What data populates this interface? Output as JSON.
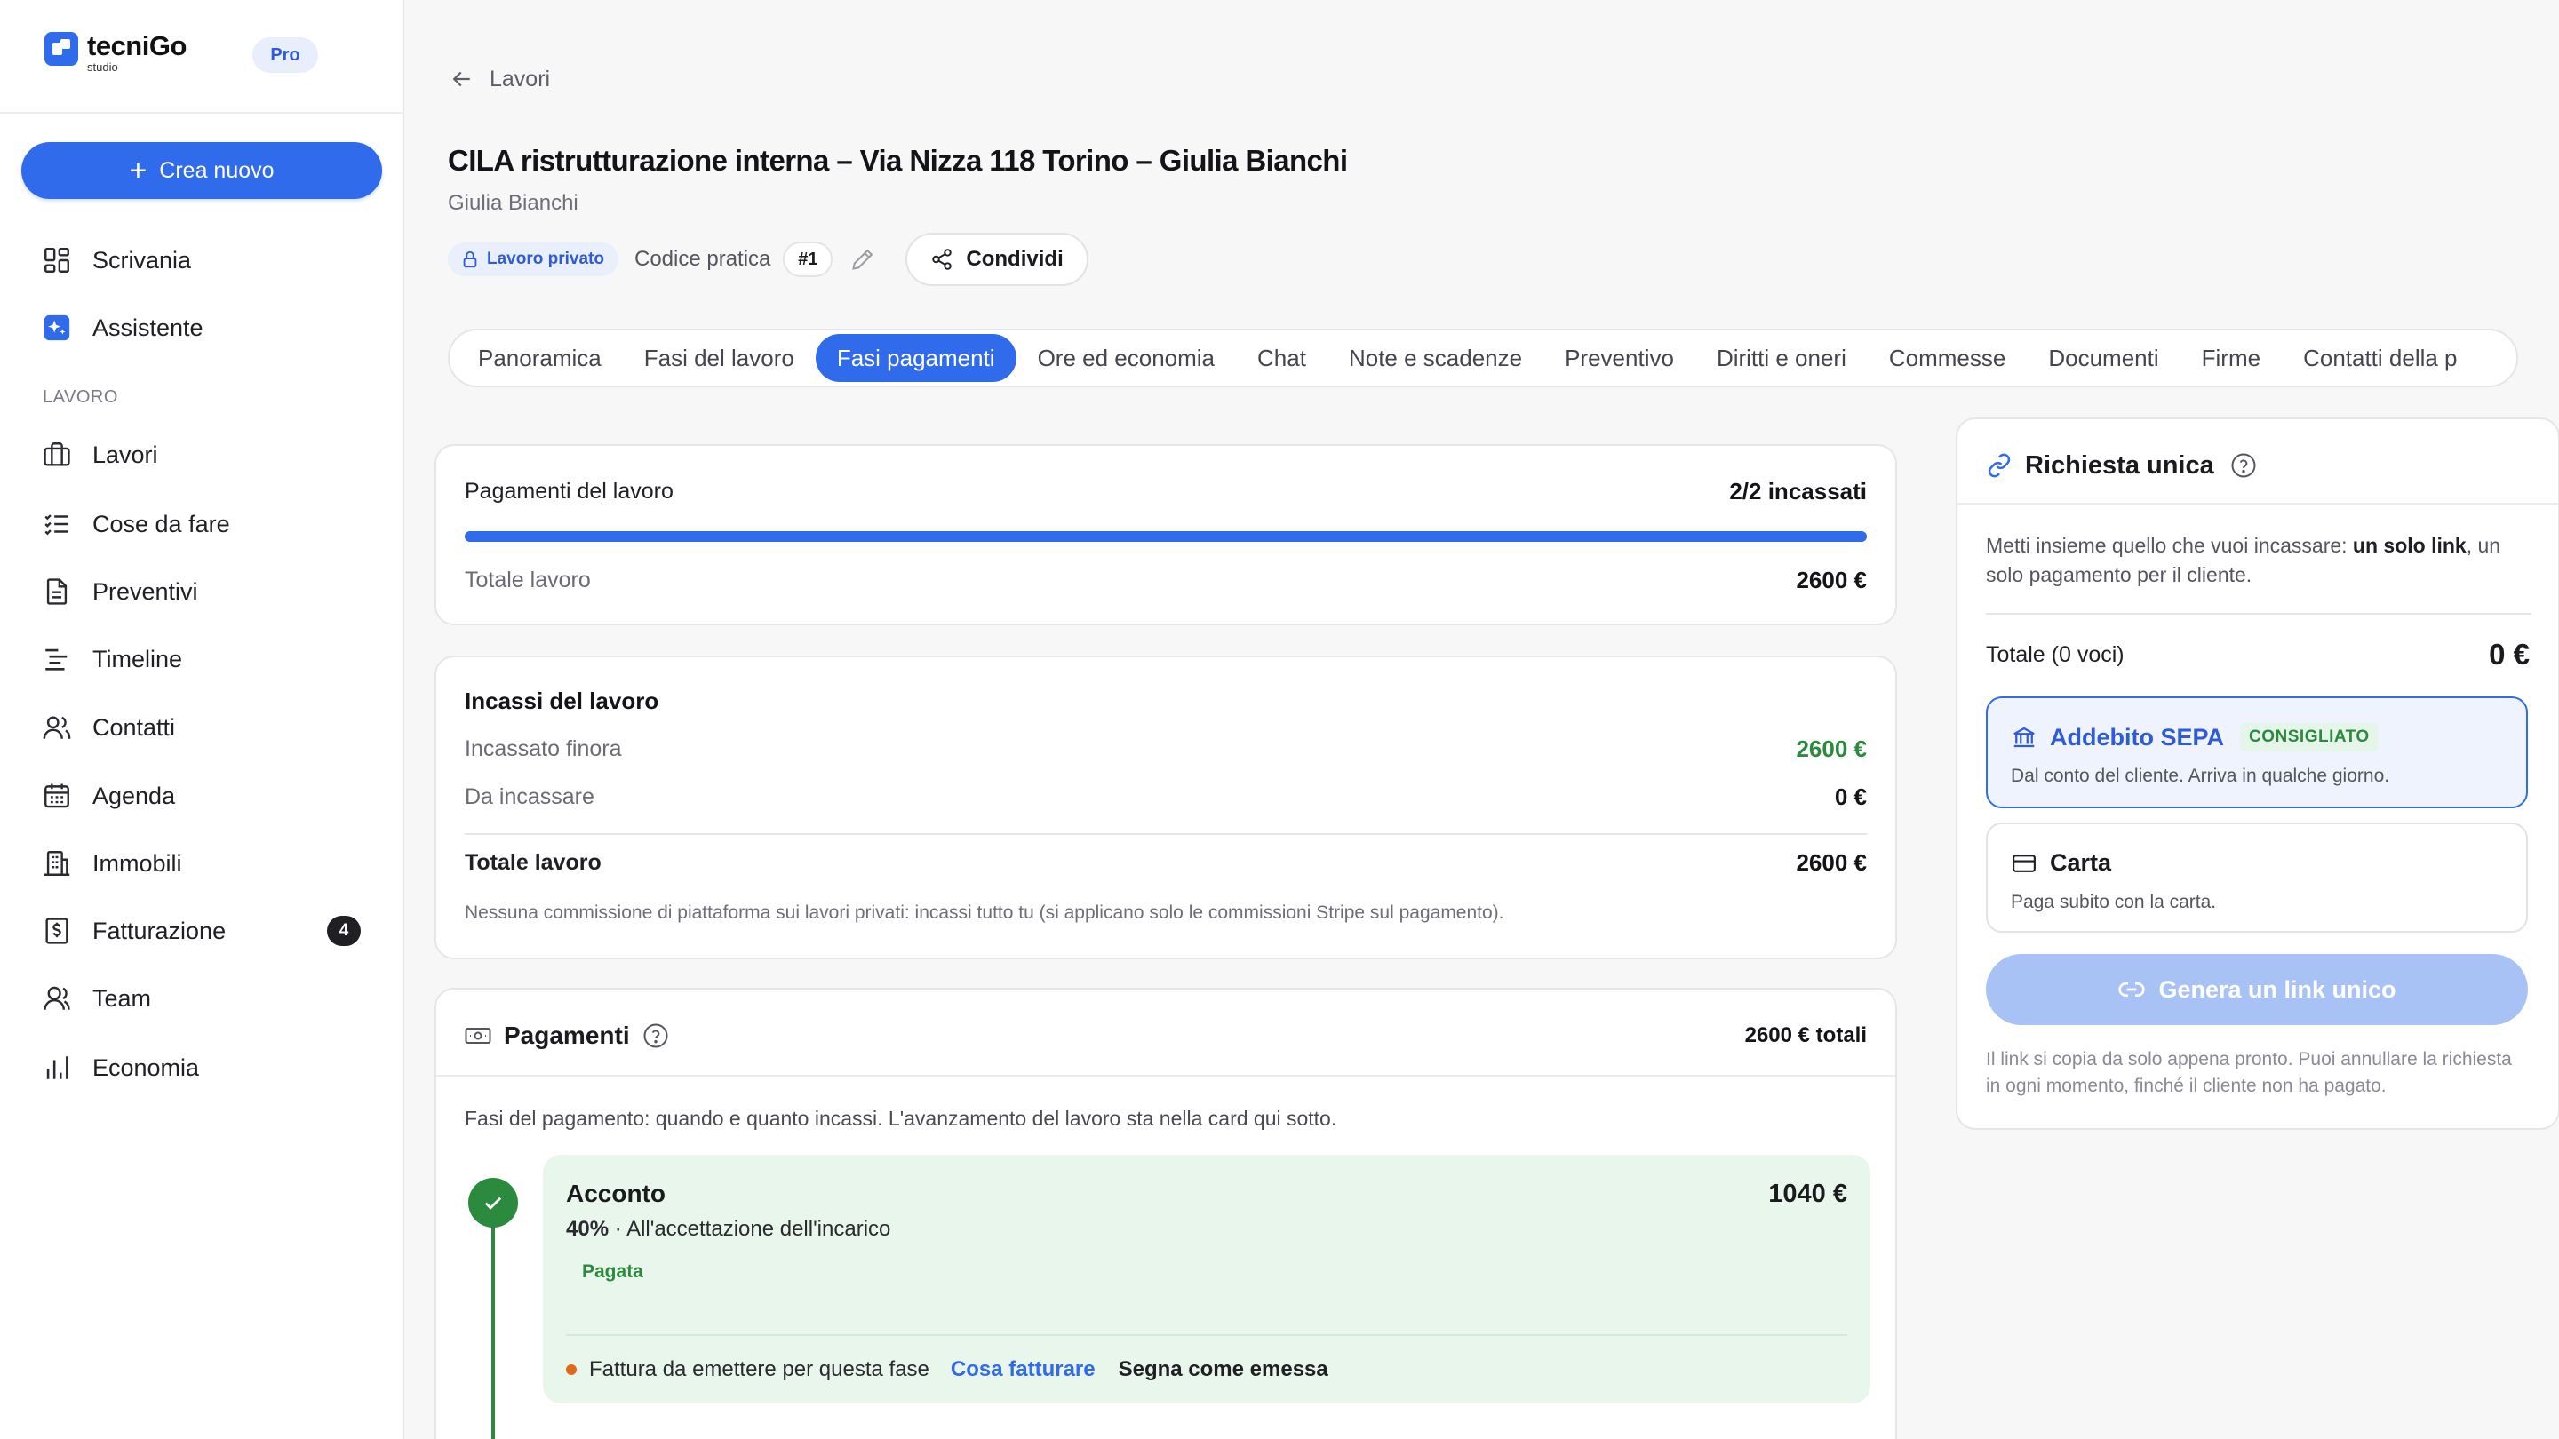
{
  "app": {
    "brand_name": "tecniGo",
    "brand_sub": "studio",
    "plan_badge": "Pro"
  },
  "sidebar": {
    "create_label": "Crea nuovo",
    "section_label": "LAVORO",
    "top_items": [
      {
        "label": "Scrivania",
        "icon": "grid-icon"
      },
      {
        "label": "Assistente",
        "icon": "sparkle-icon"
      }
    ],
    "items": [
      {
        "label": "Lavori",
        "icon": "briefcase-icon"
      },
      {
        "label": "Cose da fare",
        "icon": "checklist-icon"
      },
      {
        "label": "Preventivi",
        "icon": "document-icon"
      },
      {
        "label": "Timeline",
        "icon": "timeline-icon"
      },
      {
        "label": "Contatti",
        "icon": "users-icon"
      },
      {
        "label": "Agenda",
        "icon": "calendar-icon"
      },
      {
        "label": "Immobili",
        "icon": "building-icon"
      },
      {
        "label": "Fatturazione",
        "icon": "invoice-icon",
        "badge": "4"
      },
      {
        "label": "Team",
        "icon": "team-icon"
      },
      {
        "label": "Economia",
        "icon": "bar-chart-icon"
      }
    ]
  },
  "header": {
    "back_label": "Lavori",
    "title": "CILA ristrutturazione interna – Via Nizza 118 Torino – Giulia Bianchi",
    "subtitle": "Giulia Bianchi",
    "private_badge": "Lavoro privato",
    "code_label": "Codice pratica",
    "code_value": "#1",
    "share_label": "Condividi"
  },
  "tabs": [
    {
      "label": "Panoramica",
      "active": false
    },
    {
      "label": "Fasi del lavoro",
      "active": false
    },
    {
      "label": "Fasi pagamenti",
      "active": true
    },
    {
      "label": "Ore ed economia",
      "active": false
    },
    {
      "label": "Chat",
      "active": false
    },
    {
      "label": "Note e scadenze",
      "active": false
    },
    {
      "label": "Preventivo",
      "active": false
    },
    {
      "label": "Diritti e oneri",
      "active": false
    },
    {
      "label": "Commesse",
      "active": false
    },
    {
      "label": "Documenti",
      "active": false
    },
    {
      "label": "Firme",
      "active": false
    },
    {
      "label": "Contatti della p",
      "active": false
    }
  ],
  "payments_summary": {
    "label": "Pagamenti del lavoro",
    "status": "2/2 incassati",
    "progress_fraction": 1.0,
    "total_label": "Totale lavoro",
    "total_value": "2600 €"
  },
  "income": {
    "title": "Incassi del lavoro",
    "collected_label": "Incassato finora",
    "collected_value": "2600 €",
    "due_label": "Da incassare",
    "due_value": "0 €",
    "total_label": "Totale lavoro",
    "total_value": "2600 €",
    "note": "Nessuna commissione di piattaforma sui lavori privati: incassi tutto tu (si applicano solo le commissioni Stripe sul pagamento)."
  },
  "payments": {
    "title": "Pagamenti",
    "total": "2600 € totali",
    "intro": "Fasi del pagamento: quando e quanto incassi. L'avanzamento del lavoro sta nella card qui sotto.",
    "phase": {
      "name": "Acconto",
      "amount": "1040 €",
      "percent": "40%",
      "separator": " · ",
      "condition": "All'accettazione dell'incarico",
      "status": "Pagata",
      "invoice_text": "Fattura da emettere per questa fase",
      "invoice_link": "Cosa fatturare",
      "invoice_action": "Segna come emessa"
    }
  },
  "single_request": {
    "title": "Richiesta unica",
    "intro_pre": "Metti insieme quello che vuoi incassare: ",
    "intro_bold": "un solo link",
    "intro_post": ", un solo pagamento per il cliente.",
    "total_label": "Totale (0 voci)",
    "total_value": "0 €",
    "sepa_title": "Addebito SEPA",
    "sepa_badge": "CONSIGLIATO",
    "sepa_desc": "Dal conto del cliente. Arriva in qualche giorno.",
    "card_title": "Carta",
    "card_desc": "Paga subito con la carta.",
    "generate_label": "Genera un link unico",
    "footer": "Il link si copia da solo appena pronto. Puoi annullare la richiesta in ogni momento, finché il cliente non ha pagato."
  },
  "colors": {
    "accent": "#2f6bea",
    "success": "#2c8a3e",
    "warning_dot": "#e06a1b",
    "phase_bg": "#e8f6ec"
  }
}
